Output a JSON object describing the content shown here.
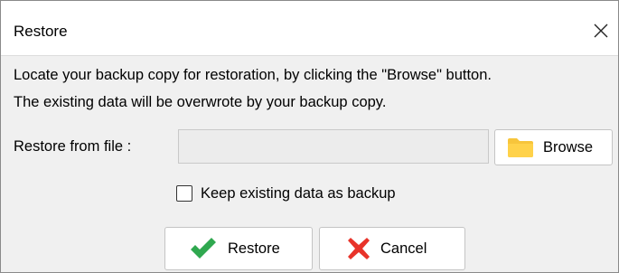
{
  "dialog": {
    "title": "Restore",
    "close_icon": "close-icon"
  },
  "message": {
    "line1": "Locate your backup copy for restoration, by clicking the \"Browse\" button.",
    "line2": "The existing data will be overwrote by your backup copy."
  },
  "file": {
    "label": "Restore from file :",
    "value": "",
    "browse_label": "Browse",
    "browse_icon": "folder-icon"
  },
  "options": {
    "keep_backup_label": "Keep existing data as backup",
    "keep_backup_checked": false
  },
  "actions": {
    "restore_label": "Restore",
    "restore_icon": "checkmark-icon",
    "cancel_label": "Cancel",
    "cancel_icon": "x-icon"
  },
  "colors": {
    "folder": "#f7c53b",
    "checkmark": "#2fa84f",
    "x_mark": "#e8332a"
  }
}
